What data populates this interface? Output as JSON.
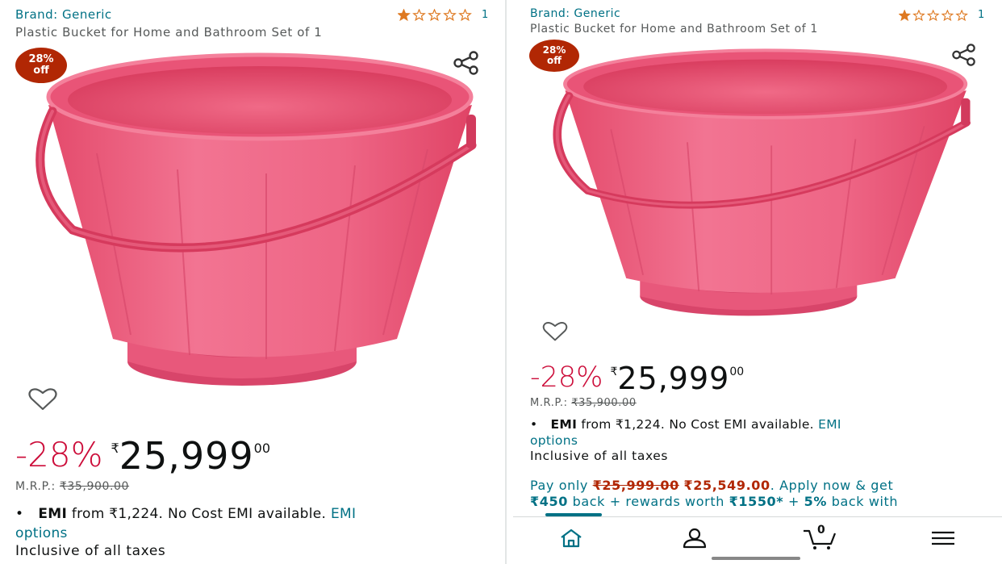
{
  "colors": {
    "link": "#007185",
    "discount": "#cc0c39",
    "badge": "#b12704",
    "bucket": "#ec5f7d",
    "star": "#de7921"
  },
  "left": {
    "brand": "Brand: Generic",
    "title": "Plastic Bucket for Home and Bathroom Set of 1",
    "rating_stars": 1,
    "rating_count": "1",
    "badge_top": "28%",
    "badge_bottom": "off",
    "share_icon": "share-icon",
    "wishlist_icon": "heart-icon",
    "discount": "-28%",
    "currency": "₹",
    "price_whole": "25,999",
    "price_fraction": "00",
    "mrp_label": "M.R.P.:",
    "mrp_value": "₹35,900.00",
    "bullet": "•",
    "emi_label": "EMI",
    "emi_text": "from ₹1,224. No Cost EMI available.",
    "emi_link": "EMI",
    "emi_link2": "options",
    "taxes": "Inclusive of all taxes"
  },
  "right": {
    "brand": "Brand: Generic",
    "title": "Plastic Bucket for Home and Bathroom Set of 1",
    "rating_stars": 1,
    "rating_count": "1",
    "badge_top": "28%",
    "badge_bottom": "off",
    "share_icon": "share-icon",
    "wishlist_icon": "heart-icon",
    "discount": "-28%",
    "currency": "₹",
    "price_whole": "25,999",
    "price_fraction": "00",
    "mrp_label": "M.R.P.:",
    "mrp_value": "₹35,900.00",
    "bullet": "•",
    "emi_label": "EMI",
    "emi_text": "from ₹1,224. No Cost EMI available.",
    "emi_link": "EMI",
    "emi_link2": "options",
    "taxes": "Inclusive of all taxes",
    "pay_prefix": "Pay only",
    "pay_old": "₹25,999.00",
    "pay_new": "₹25,549.00",
    "pay_mid": ". Apply now & get",
    "pay_cashback": "₹450",
    "pay_back": "back + rewards worth",
    "pay_rewards": "₹1550*",
    "pay_plus": "+",
    "pay_percent": "5%",
    "pay_tail": "back with",
    "nav": {
      "home_icon": "home-icon",
      "account_icon": "user-icon",
      "cart_icon": "cart-icon",
      "cart_count": "0",
      "menu_icon": "menu-icon"
    }
  }
}
